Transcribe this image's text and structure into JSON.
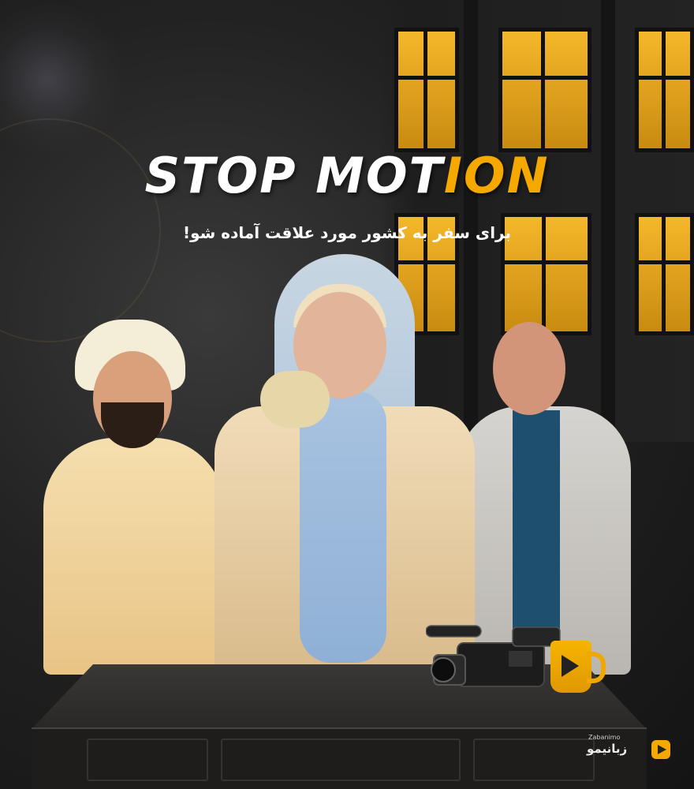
{
  "poster": {
    "title_part1": "STOP MOT",
    "title_part2": "ION",
    "subtitle": "برای سفر به کشور مورد علاقت آماده شو!",
    "brand": {
      "small_label": "Zabanimo",
      "name": "زبانیمو"
    }
  },
  "colors": {
    "accent": "#f5a800",
    "title_text": "#ffffff",
    "window_light": "#f5b72a",
    "background": "#1e1e1e"
  }
}
